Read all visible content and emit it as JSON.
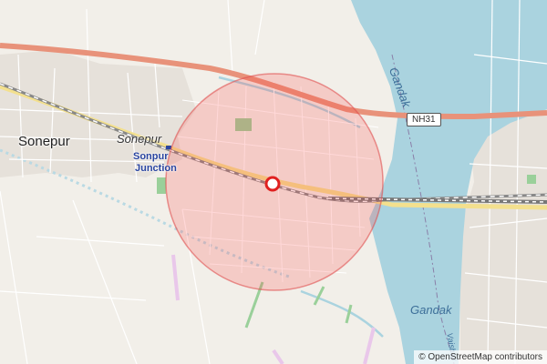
{
  "map": {
    "labels": {
      "city": "Sonepur",
      "place": "Sonepur",
      "station_line1": "Sonpur",
      "station_line2": "Junction",
      "river_top": "Gandak",
      "river_bottom": "Gandak",
      "river_vertical": "Vaishali",
      "highway": "NH31"
    },
    "attribution_symbol": "©",
    "attribution_link": "OpenStreetMap contributors",
    "colors": {
      "background": "#f2efe9",
      "water": "#aad3df",
      "highway": "#e8927a",
      "radius_fill": "#ff3b3b",
      "radius_stroke": "#e05050",
      "marker_ring": "#e02020",
      "railway": "#888888",
      "park": "#9ad09a"
    },
    "marker_icon": "location-pin-icon"
  }
}
